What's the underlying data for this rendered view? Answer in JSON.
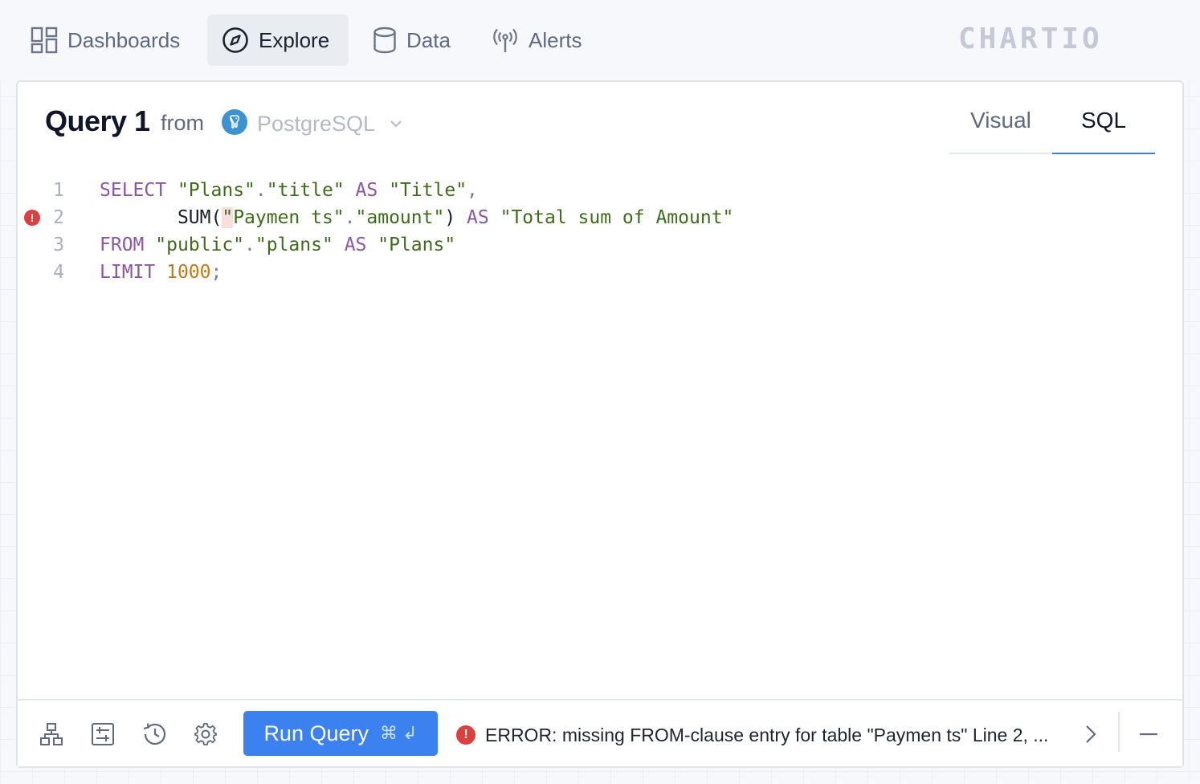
{
  "nav": {
    "items": [
      {
        "label": "Dashboards",
        "icon": "dashboard-grid-icon"
      },
      {
        "label": "Explore",
        "icon": "compass-icon",
        "active": true
      },
      {
        "label": "Data",
        "icon": "database-icon"
      },
      {
        "label": "Alerts",
        "icon": "broadcast-antenna-icon"
      }
    ],
    "brand": "CHARTIO"
  },
  "query": {
    "title": "Query 1",
    "from_label": "from",
    "source": "PostgreSQL",
    "source_icon": "postgresql-elephant-icon"
  },
  "mode_tabs": [
    {
      "label": "Visual",
      "active": false
    },
    {
      "label": "SQL",
      "active": true
    }
  ],
  "editor": {
    "lines": [
      {
        "number": "1",
        "has_error": false
      },
      {
        "number": "2",
        "has_error": true
      },
      {
        "number": "3",
        "has_error": false
      },
      {
        "number": "4",
        "has_error": false
      }
    ],
    "tokens": {
      "l1_select": "SELECT",
      "l1_plans": "\"Plans\"",
      "l1_dot": ".",
      "l1_title": "\"title\"",
      "l1_as": "AS",
      "l1_alias": "\"Title\"",
      "l1_comma": ",",
      "l2_indent": "       ",
      "l2_sum": "SUM(",
      "l2_quote": "\"",
      "l2_paymen": "Paymen ts\"",
      "l2_dot": ".",
      "l2_amount": "\"amount\"",
      "l2_close": ")",
      "l2_as": "AS",
      "l2_alias": "\"Total sum of Amount\"",
      "l3_from": "FROM",
      "l3_public": "\"public\"",
      "l3_dot": ".",
      "l3_plans": "\"plans\"",
      "l3_as": "AS",
      "l3_alias": "\"Plans\"",
      "l4_limit": "LIMIT",
      "l4_num": "1000",
      "l4_semi": ";"
    }
  },
  "toolbar": {
    "tools": [
      "schema-tree-icon",
      "query-settings-panel-icon",
      "history-clock-icon",
      "gear-icon"
    ],
    "run_label": "Run Query",
    "run_shortcut": "⌘ ↲",
    "error_message": "ERROR: missing FROM-clause entry for table \"Paymen ts\" Line 2, ..."
  },
  "colors": {
    "accent": "#3b82f0",
    "error": "#d94040",
    "keyword": "#8b56a6",
    "string": "#3f6b1c",
    "number": "#c07a1a"
  }
}
